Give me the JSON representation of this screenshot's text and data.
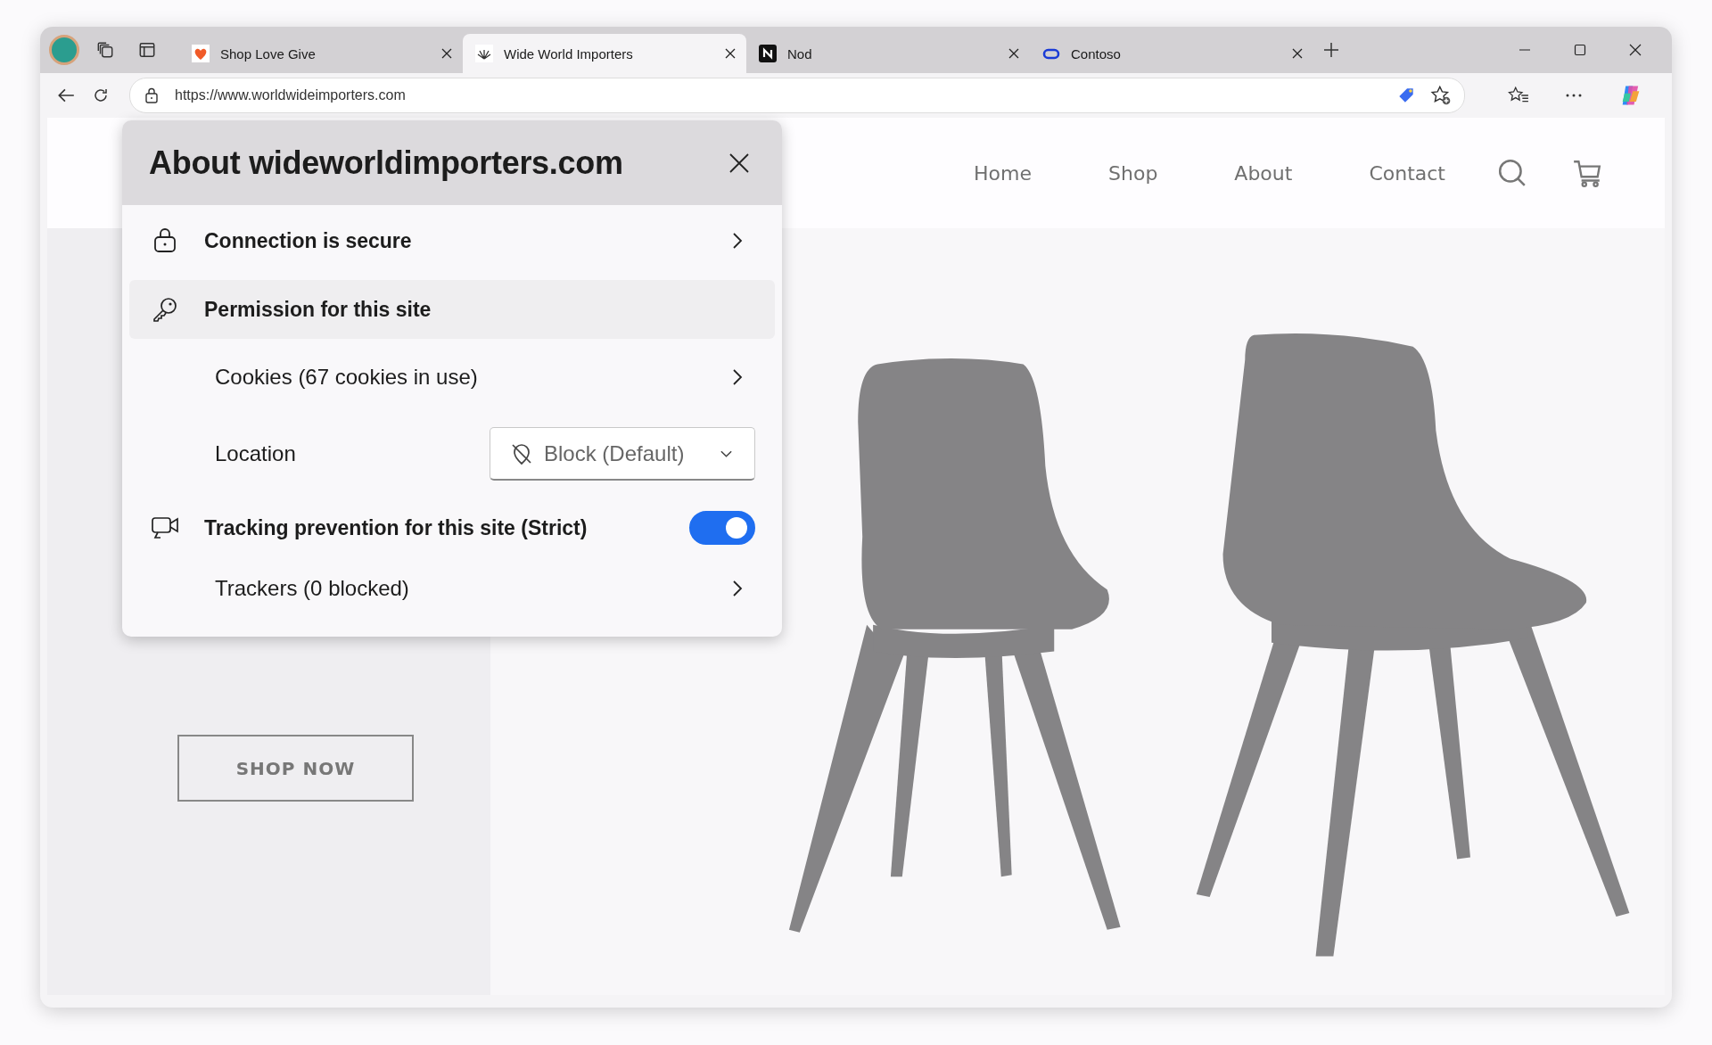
{
  "tabs": [
    {
      "title": "Shop Love Give",
      "selected": false
    },
    {
      "title": "Wide World Importers",
      "selected": true
    },
    {
      "title": "Nod",
      "selected": false
    },
    {
      "title": "Contoso",
      "selected": false
    }
  ],
  "address_bar": {
    "url": "https://www.worldwideimporters.com"
  },
  "site_nav": [
    "Home",
    "Shop",
    "About",
    "Contact"
  ],
  "hero": {
    "button": "SHOP NOW"
  },
  "site_info_popup": {
    "title": "About wideworldimporters.com",
    "connection": {
      "label": "Connection is secure"
    },
    "permissions": {
      "label": "Permission for this site",
      "selected": true
    },
    "cookies": {
      "label": "Cookies (67 cookies in use)"
    },
    "location": {
      "label": "Location",
      "value": "Block (Default)"
    },
    "tracking": {
      "label": "Tracking prevention for this site (Strict)",
      "on": true
    },
    "trackers": {
      "label": "Trackers (0 blocked)"
    }
  }
}
